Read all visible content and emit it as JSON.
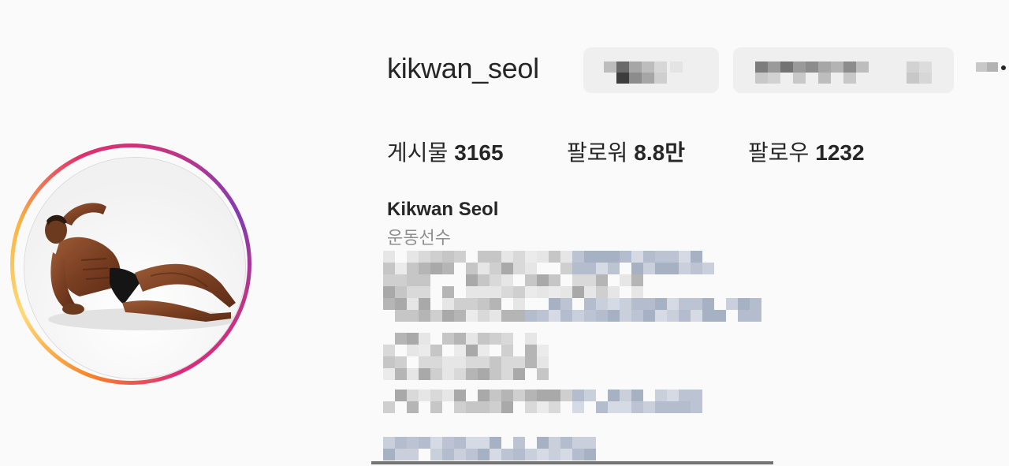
{
  "profile": {
    "username": "kikwan_seol",
    "full_name": "Kikwan Seol",
    "category": "운동선수",
    "avatar_alt": "profile-photo"
  },
  "stats": {
    "posts_label": "게시물",
    "posts_value": "3165",
    "followers_label": "팔로워",
    "followers_value": "8.8만",
    "following_label": "팔로우",
    "following_value": "1232"
  },
  "colors": {
    "text": "#262626",
    "secondary_text": "#8e8e8e",
    "background": "#fafafa",
    "link_blur": "#9aa5bd",
    "story_ring": [
      "#feda77",
      "#f58529",
      "#dd2a7b",
      "#8134af"
    ]
  },
  "icons": {
    "more": "more-options-icon"
  }
}
